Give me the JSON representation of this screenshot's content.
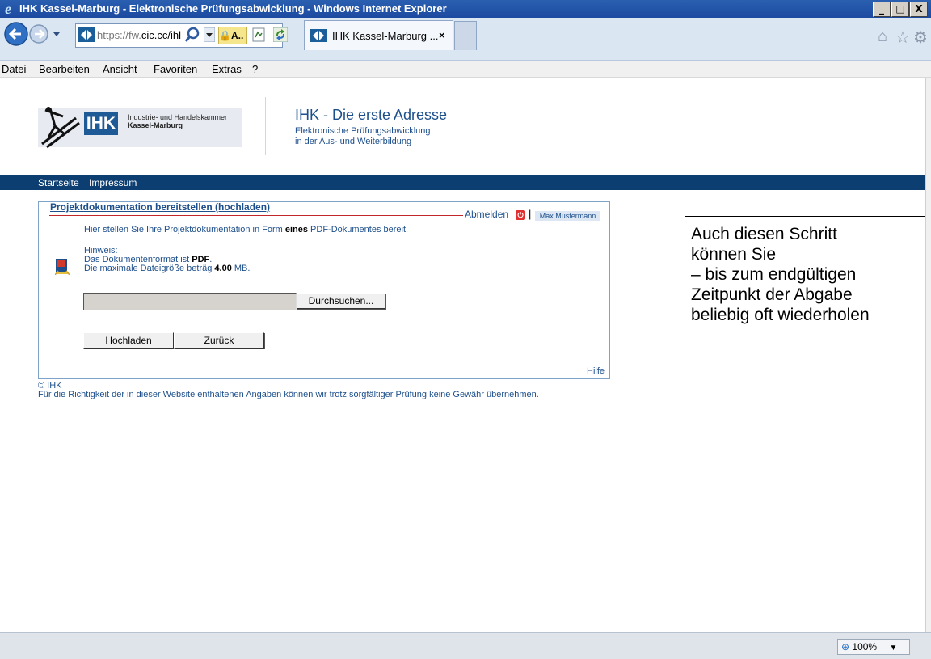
{
  "window": {
    "title": "IHK Kassel-Marburg - Elektronische Prüfungsabwicklung - Windows Internet Explorer",
    "controls": [
      "_",
      "□",
      "X"
    ]
  },
  "navbar": {
    "url_host": "https://fw.",
    "url_rest": "cic.cc/ihl",
    "lock_label": "A..",
    "tab_label": "IHK Kassel-Marburg ...",
    "tab_close": "×"
  },
  "menu": {
    "items": [
      "Datei",
      "Bearbeiten",
      "Ansicht",
      "Favoriten",
      "Extras",
      "?"
    ]
  },
  "header": {
    "logo_text": "IHK",
    "org_line1": "Industrie- und Handelskammer",
    "org_line2": "Kassel-Marburg",
    "title": "IHK - Die erste Adresse",
    "subtitle_line1": "Elektronische Prüfungsabwicklung",
    "subtitle_line2": "in der Aus- und Weiterbildung"
  },
  "nav": {
    "startseite": "Startseite",
    "impressum": "Impressum"
  },
  "panel": {
    "title": "Projektdokumentation bereitstellen (hochladen)",
    "abmelden": "Abmelden",
    "user": "Max Mustermann",
    "intro_pre": "Hier stellen Sie Ihre Projektdokumentation in Form ",
    "intro_bold": "eines",
    "intro_post": " PDF-Dokumentes bereit.",
    "hinweis_label": "Hinweis:",
    "format_pre": "Das Dokumentenformat ist ",
    "format_bold": "PDF",
    "format_post": ".",
    "size_pre": "Die maximale Dateigröße beträg ",
    "size_bold": "4.00",
    "size_post": " MB.",
    "browse_label": "Durchsuchen...",
    "upload_label": "Hochladen",
    "back_label": "Zurück",
    "help_label": "Hilfe"
  },
  "footer": {
    "copyright": "© IHK",
    "disclaimer": "Für die Richtigkeit der in dieser Website enthaltenen Angaben können wir trotz sorgfältiger Prüfung keine Gewähr übernehmen."
  },
  "note": {
    "lines": [
      "Auch diesen Schritt",
      "können Sie",
      "– bis zum endgültigen",
      "Zeitpunkt der Abgabe",
      "beliebig oft wiederholen"
    ]
  },
  "status": {
    "zoom": "100%"
  }
}
